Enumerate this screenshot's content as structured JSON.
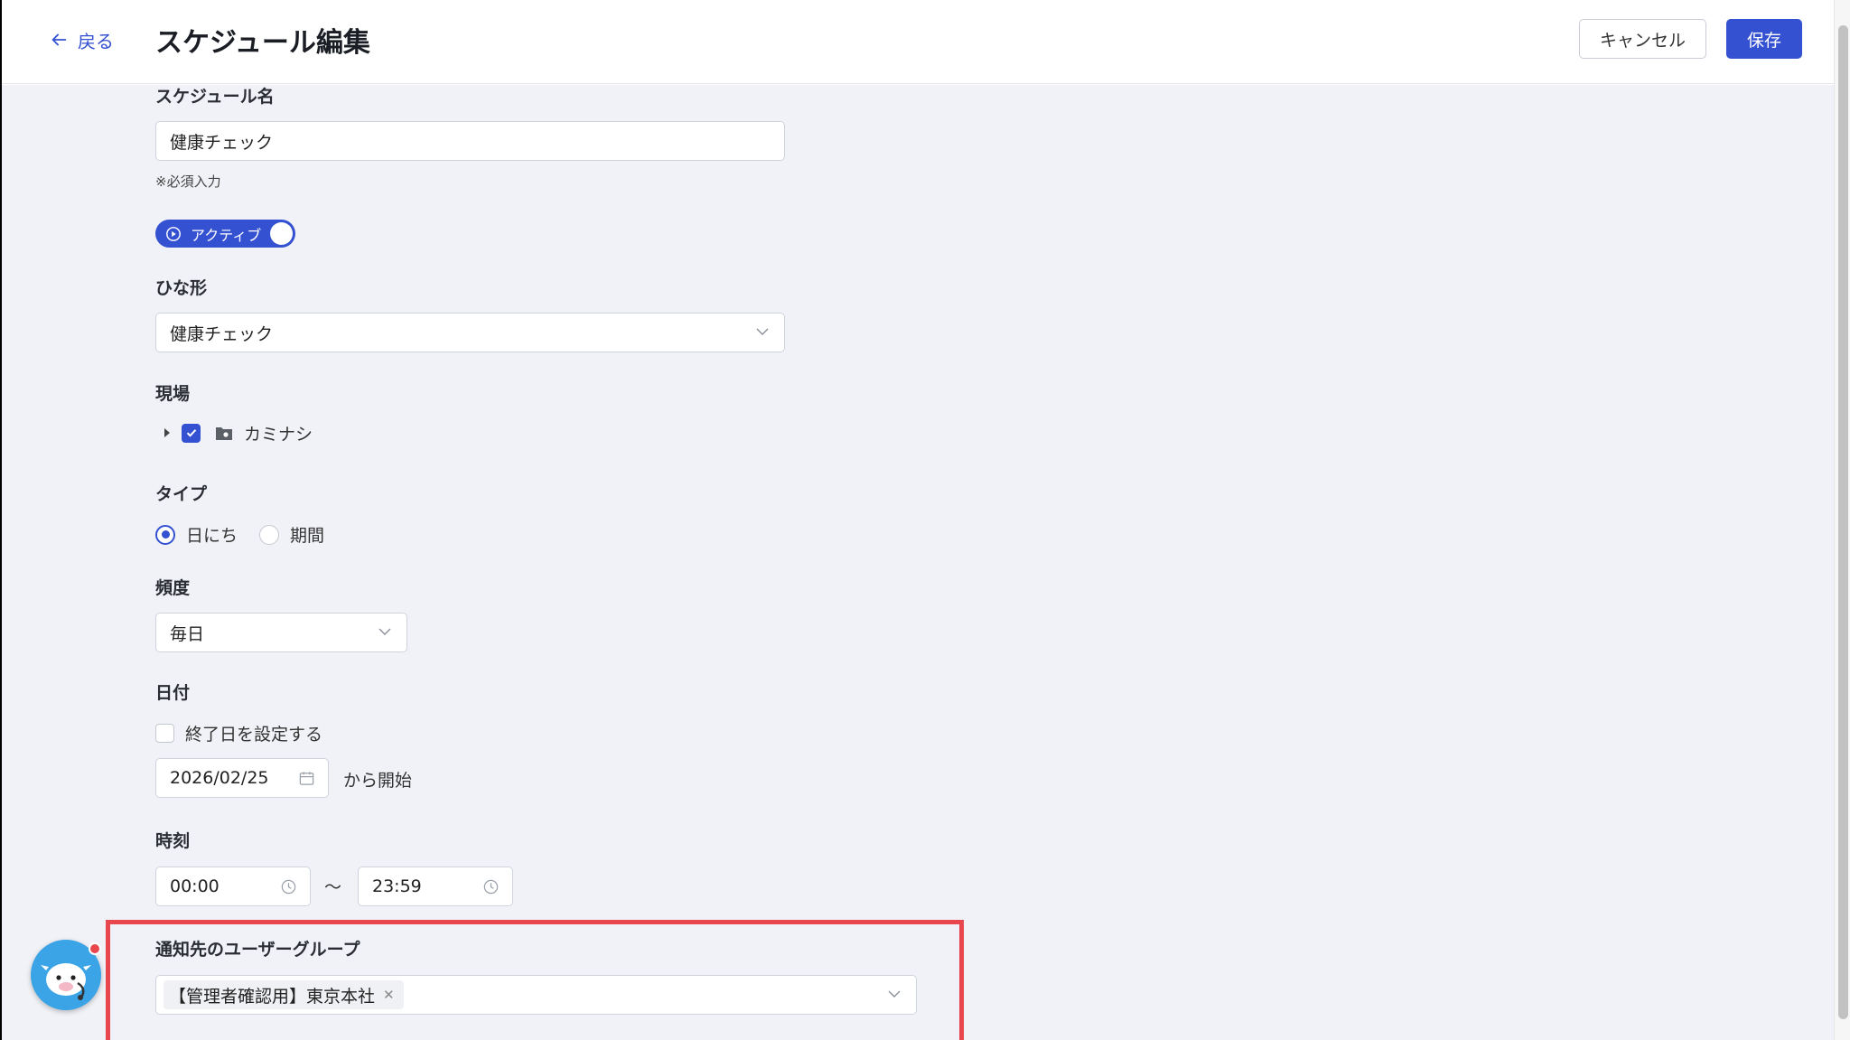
{
  "header": {
    "back_label": "戻る",
    "title": "スケジュール編集",
    "cancel_label": "キャンセル",
    "save_label": "保存"
  },
  "form": {
    "name": {
      "label": "スケジュール名",
      "value": "健康チェック",
      "hint": "※必須入力"
    },
    "status_toggle": {
      "label": "アクティブ",
      "on": true
    },
    "template": {
      "label": "ひな形",
      "value": "健康チェック"
    },
    "site": {
      "label": "現場",
      "items": [
        {
          "name": "カミナシ",
          "checked": true
        }
      ]
    },
    "type": {
      "label": "タイプ",
      "options": [
        "日にち",
        "期間"
      ],
      "selected": "日にち"
    },
    "frequency": {
      "label": "頻度",
      "value": "毎日"
    },
    "date": {
      "label": "日付",
      "end_date_checkbox": "終了日を設定する",
      "end_date_checked": false,
      "start_date": "2026/02/25",
      "start_suffix": "から開始"
    },
    "time": {
      "label": "時刻",
      "start": "00:00",
      "separator": "〜",
      "end": "23:59"
    },
    "notify_groups": {
      "label": "通知先のユーザーグループ",
      "tags": [
        "【管理者確認用】東京本社"
      ]
    }
  },
  "colors": {
    "accent": "#3451d1",
    "highlight": "#e8474e",
    "background": "#f1f2f7"
  }
}
